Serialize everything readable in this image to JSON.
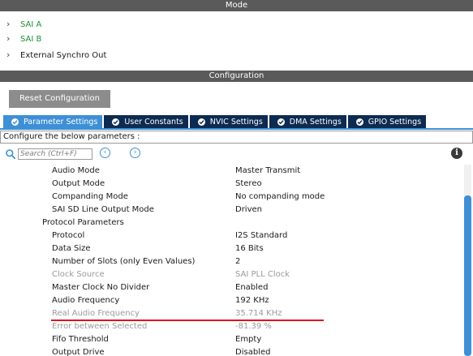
{
  "mode": {
    "title": "Mode",
    "items": [
      {
        "label": "SAI A"
      },
      {
        "label": "SAI B"
      },
      {
        "label": "External Synchro Out"
      }
    ]
  },
  "configuration": {
    "title": "Configuration",
    "reset_label": "Reset Configuration",
    "tabs": [
      {
        "label": "Parameter Settings",
        "active": true
      },
      {
        "label": "User Constants",
        "active": false
      },
      {
        "label": "NVIC Settings",
        "active": false
      },
      {
        "label": "DMA Settings",
        "active": false
      },
      {
        "label": "GPIO Settings",
        "active": false
      }
    ],
    "configure_text": "Configure the below parameters :",
    "search_placeholder": "Search (Ctrl+F)",
    "params": [
      {
        "name": "Audio Mode",
        "value": "Master Transmit"
      },
      {
        "name": "Output Mode",
        "value": "Stereo"
      },
      {
        "name": "Companding Mode",
        "value": "No companding mode"
      },
      {
        "name": "SAI SD Line Output Mode",
        "value": "Driven"
      },
      {
        "name": "Protocol Parameters",
        "value": ""
      },
      {
        "name": "Protocol",
        "value": "I2S Standard"
      },
      {
        "name": "Data Size",
        "value": "16 Bits"
      },
      {
        "name": "Number of Slots (only Even Values)",
        "value": "2"
      },
      {
        "name": "Clock Source",
        "value": "SAI PLL Clock"
      },
      {
        "name": "Master Clock No Divider",
        "value": "Enabled"
      },
      {
        "name": "Audio Frequency",
        "value": "192 KHz"
      },
      {
        "name": "Real Audio Frequency",
        "value": "35.714 KHz"
      },
      {
        "name": "Error between Selected",
        "value": "-81.39 %"
      },
      {
        "name": "Fifo Threshold",
        "value": "Empty"
      },
      {
        "name": "Output Drive",
        "value": "Disabled"
      }
    ]
  },
  "colors": {
    "accent_blue": "#3e8fd6",
    "tab_dark": "#0d2b52",
    "mode_green": "#1e8c3a",
    "highlight_red": "#e0101a",
    "disabled_gray": "#9a9a9a"
  }
}
